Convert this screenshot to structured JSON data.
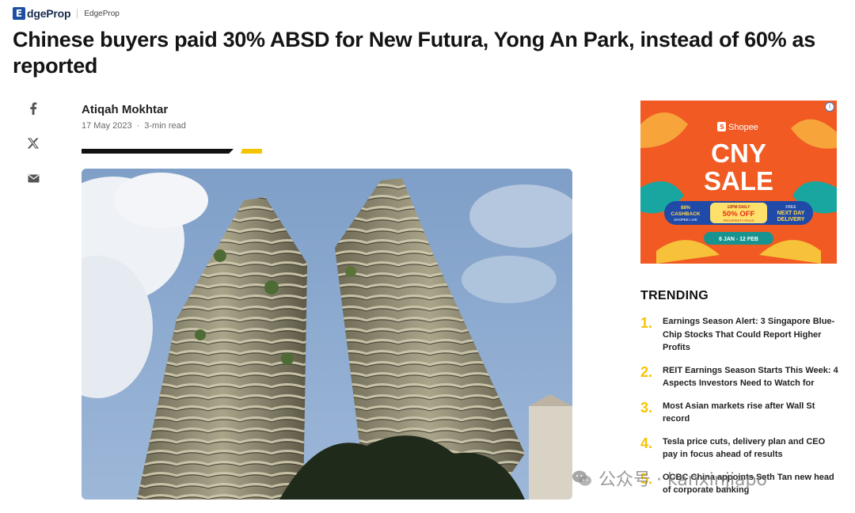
{
  "header": {
    "logo_letter": "E",
    "logo_text": "dgeProp",
    "crumb": "EdgeProp",
    "brand_color": "#1d4fa3"
  },
  "article": {
    "headline": "Chinese buyers paid 30% ABSD for New Futura, Yong An Park, instead of 60% as reported",
    "author": "Atiqah Mokhtar",
    "date": "17 May 2023",
    "separator": "·",
    "read_time": "3-min read",
    "accent_color": "#f5c400"
  },
  "share": {
    "facebook_icon": "facebook-icon",
    "x_icon": "x-twitter-icon",
    "email_icon": "email-icon"
  },
  "ad": {
    "brand": "Shopee",
    "headline_line1": "CNY",
    "headline_line2": "SALE",
    "badge_left_line1": "88%",
    "badge_left_line2": "CASHBACK",
    "badge_left_line3": "SHOPEE LIVE",
    "badge_center_line1": "12PM DAILY",
    "badge_center_line2": "50% OFF",
    "badge_center_line3": "PROSPERITY PICKS",
    "badge_right_line1": "FREE",
    "badge_right_line2": "NEXT DAY",
    "badge_right_line3": "DELIVERY",
    "dates": "6 JAN - 12 FEB",
    "info_icon": "i"
  },
  "trending": {
    "title": "TRENDING",
    "items": [
      {
        "num": "1.",
        "text": "Earnings Season Alert: 3 Singapore Blue-Chip Stocks That Could Report Higher Profits"
      },
      {
        "num": "2.",
        "text": "REIT Earnings Season Starts This Week: 4 Aspects Investors Need to Watch for"
      },
      {
        "num": "3.",
        "text": "Most Asian markets rise after Wall St record"
      },
      {
        "num": "4.",
        "text": "Tesla price cuts, delivery plan and CEO pay in focus ahead of results"
      },
      {
        "num": "5.",
        "text": "OCBC China appoints Seth Tan new head of corporate banking"
      }
    ]
  },
  "watermark": {
    "text": "公众号 · kanxinjiapo"
  }
}
